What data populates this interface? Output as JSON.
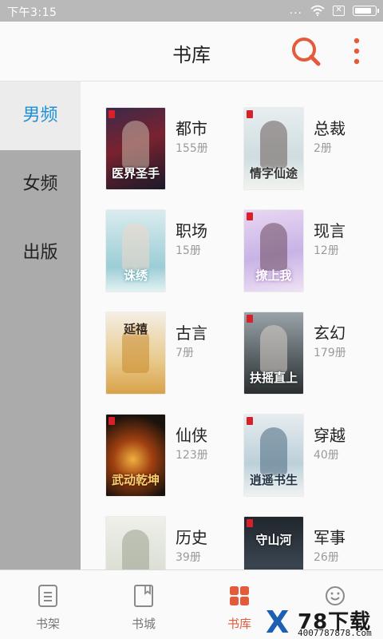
{
  "status_bar": {
    "time": "下午3:15",
    "dots": "...",
    "battery_level": 0.9
  },
  "app_bar": {
    "title": "书库",
    "search_icon": "search-icon",
    "more_icon": "more-vertical-icon",
    "accent": "#e35b3a"
  },
  "sidebar": {
    "items": [
      {
        "label": "男频",
        "active": true
      },
      {
        "label": "女频",
        "active": false
      },
      {
        "label": "出版",
        "active": false
      }
    ],
    "active_color": "#1d90d6"
  },
  "categories": [
    {
      "name": "都市",
      "count": "155册",
      "cover_title": "医界圣手"
    },
    {
      "name": "总裁",
      "count": "2册",
      "cover_title": "情字仙途"
    },
    {
      "name": "职场",
      "count": "15册",
      "cover_title": "诛绣"
    },
    {
      "name": "现言",
      "count": "12册",
      "cover_title": "撩上我"
    },
    {
      "name": "古言",
      "count": "7册",
      "cover_title": "延禧"
    },
    {
      "name": "玄幻",
      "count": "179册",
      "cover_title": "扶摇直上"
    },
    {
      "name": "仙侠",
      "count": "123册",
      "cover_title": "武动乾坤"
    },
    {
      "name": "穿越",
      "count": "40册",
      "cover_title": "逍遥书生"
    },
    {
      "name": "历史",
      "count": "39册",
      "cover_title": ""
    },
    {
      "name": "军事",
      "count": "26册",
      "cover_title": "守山河"
    }
  ],
  "bottom_nav": {
    "tabs": [
      {
        "label": "书架",
        "icon": "bookshelf-icon",
        "active": false
      },
      {
        "label": "书城",
        "icon": "bookstore-icon",
        "active": false
      },
      {
        "label": "书库",
        "icon": "library-grid-icon",
        "active": true
      },
      {
        "label": "",
        "icon": "smiley-icon",
        "active": false
      }
    ]
  },
  "watermark": {
    "brand": "78下载",
    "url": "4007787878.com"
  }
}
